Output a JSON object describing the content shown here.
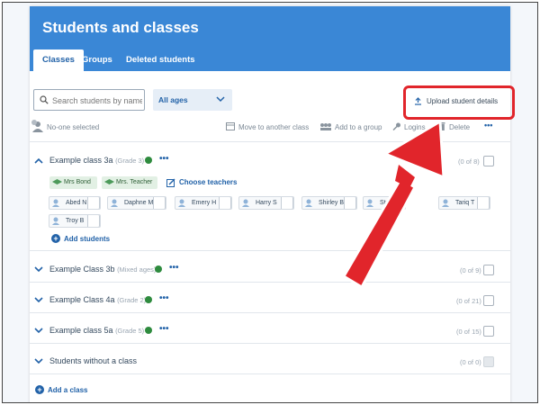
{
  "header": {
    "title": "Students and classes"
  },
  "tabs": [
    {
      "label": "Classes",
      "active": true
    },
    {
      "label": "Groups",
      "active": false
    },
    {
      "label": "Deleted students",
      "active": false
    }
  ],
  "search": {
    "placeholder": "Search students by name"
  },
  "ages_filter": {
    "selected": "All ages"
  },
  "upload": {
    "label": "Upload student details"
  },
  "toolbar": {
    "selection": "No-one selected",
    "move": "Move to another class",
    "add_group": "Add to a group",
    "logins": "Logins",
    "delete": "Delete",
    "more": "•••"
  },
  "classes": [
    {
      "name": "Example class 3a",
      "grade": "(Grade 3)",
      "count": "(0 of 8)",
      "expanded": true,
      "teachers": [
        "Mrs Bond",
        "Mrs. Teacher"
      ],
      "choose_teachers": "Choose teachers",
      "students": [
        "Abed N",
        "Daphne M",
        "Emery H",
        "Harry S",
        "Shirley B",
        "Stude",
        "Tariq T",
        "Troy B"
      ],
      "add_students": "Add students"
    },
    {
      "name": "Example Class 3b",
      "grade": "(Mixed ages)",
      "count": "(0 of 9)"
    },
    {
      "name": "Example Class 4a",
      "grade": "(Grade 2)",
      "count": "(0 of 21)"
    },
    {
      "name": "Example class 5a",
      "grade": "(Grade 5)",
      "count": "(0 of 15)"
    },
    {
      "name": "Students without a class",
      "grade": "",
      "count": "(0 of 0)"
    }
  ],
  "add_class": "Add a class",
  "colors": {
    "brand": "#3a87d6",
    "link": "#2262a8",
    "annotation": "#e1252b"
  }
}
